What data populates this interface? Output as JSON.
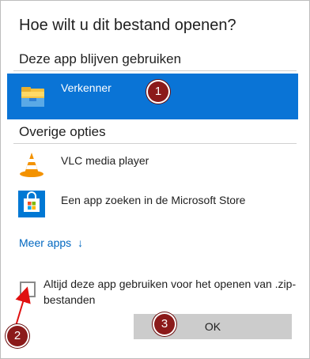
{
  "dialog": {
    "title": "Hoe wilt u dit bestand openen?",
    "keep_section": "Deze app blijven gebruiken",
    "current_app": {
      "label": "Verkenner",
      "icon": "folder-icon"
    },
    "other_section": "Overige opties",
    "apps": [
      {
        "label": "VLC media player",
        "icon": "vlc-cone-icon"
      },
      {
        "label": "Een app zoeken in de Microsoft Store",
        "icon": "store-bag-icon"
      }
    ],
    "more_apps": "Meer apps",
    "more_arrow": "↓",
    "checkbox_label": "Altijd deze app gebruiken voor het openen van .zip-bestanden",
    "checkbox_checked": false,
    "ok_label": "OK"
  },
  "annotations": {
    "badge1": "1",
    "badge2": "2",
    "badge3": "3"
  },
  "colors": {
    "accent": "#0a74d6",
    "badge": "#8b1a1a",
    "link": "#0067c0",
    "arrow": "#e01010"
  }
}
